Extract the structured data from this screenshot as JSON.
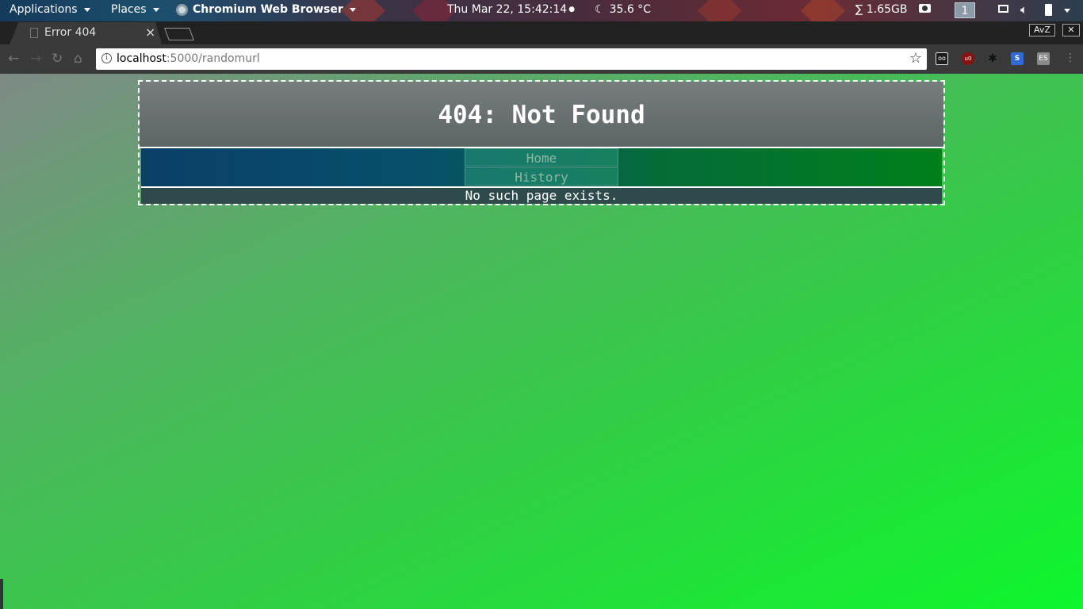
{
  "topbar": {
    "applications": "Applications",
    "places": "Places",
    "app_name": "Chromium Web Browser",
    "clock": "Thu Mar 22, 15:42:14",
    "clock_dot": "●",
    "temperature": "35.6 °C",
    "memory": "∑ 1.65GB",
    "workspace": "1"
  },
  "browser": {
    "tab_title": "Error 404",
    "tab_close": "×",
    "url_host": "localhost",
    "url_rest": ":5000/randomurl",
    "avz_label": "AvZ",
    "close_window": "✕",
    "ext_labels": {
      "e1": "oo",
      "e2": "u0",
      "e4": "S",
      "e5": "ES"
    }
  },
  "page": {
    "heading": "404: Not Found",
    "nav_items": [
      "Home",
      "History"
    ],
    "message": "No such page exists."
  },
  "colors": {
    "page_gradient_start": "#7f8a86",
    "page_gradient_end": "#0df72c",
    "nav_gradient_start": "#0b3f68",
    "nav_gradient_end": "#007f1a",
    "link_text": "#8fb7a4"
  }
}
